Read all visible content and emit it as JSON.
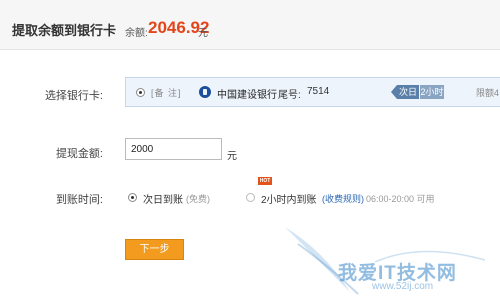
{
  "header": {
    "title": "提取余额到银行卡",
    "balance_label": "余额:",
    "balance_amount": "2046.92",
    "balance_unit": "元"
  },
  "bank_card": {
    "label": "选择银行卡:",
    "note_tag": "[备 注]",
    "bank_name": "中国建设银行",
    "tail_label": "尾号:",
    "tail_number": "7514",
    "badge_next_day": "次日",
    "badge_two_hours": "2小时",
    "limit_text": "限额4"
  },
  "amount": {
    "label": "提现金额:",
    "value": "2000",
    "unit": "元"
  },
  "arrival": {
    "label": "到账时间:",
    "options": [
      {
        "label": "次日到账",
        "sub": "(免费)",
        "selected": true
      },
      {
        "label": "2小时内到账",
        "link": "(收费规则)",
        "sub": "06:00-20:00 可用",
        "badge": "HOT",
        "selected": false
      }
    ]
  },
  "next_button": "下一步",
  "watermark": {
    "text": "我爱IT技术网",
    "url": "www.52ij.com"
  },
  "colors": {
    "accent_orange": "#f29b1e",
    "balance_red": "#e4441a",
    "link_blue": "#2a67b3",
    "bank_box_bg": "#eef4fb"
  }
}
